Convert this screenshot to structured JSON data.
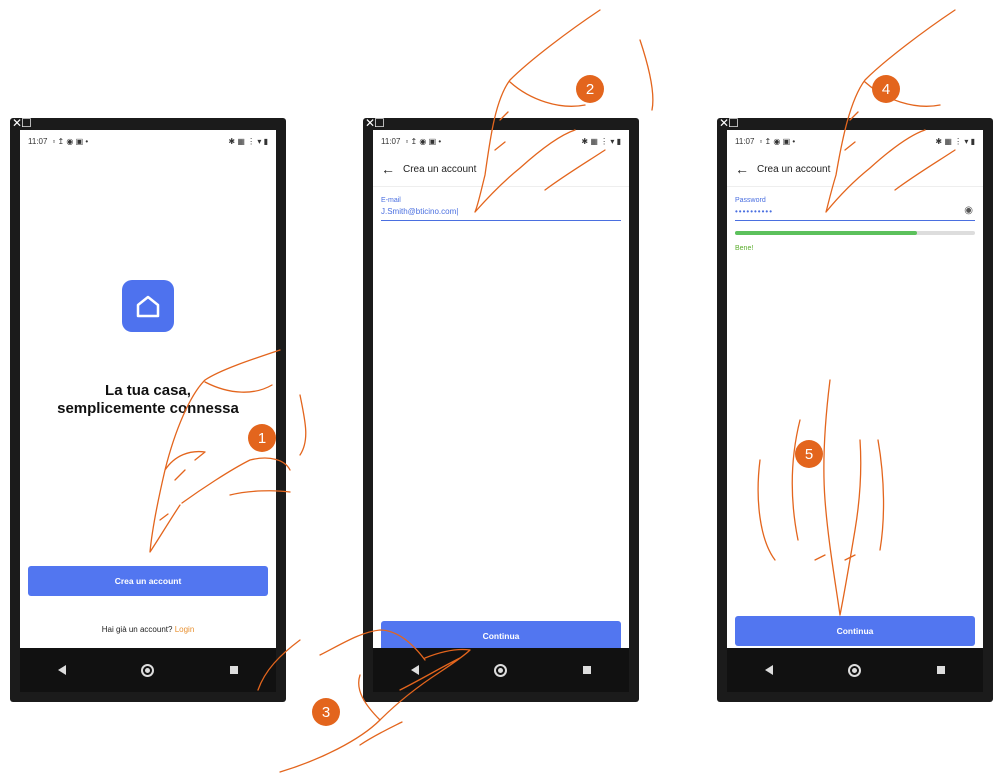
{
  "status_time": "11:07",
  "window_icons": "✕☐",
  "phone1": {
    "headline_line1": "La tua casa,",
    "headline_line2": "semplicemente connessa",
    "create_button": "Crea un account",
    "login_prompt": "Hai già un account?",
    "login_link": "Login"
  },
  "phone2": {
    "title": "Crea un account",
    "email_label": "E-mail",
    "email_value": "J.Smith@bticino.com",
    "continue_button": "Continua"
  },
  "phone3": {
    "title": "Crea un account",
    "password_label": "Password",
    "password_value": "••••••••••",
    "strength_fraction": 0.76,
    "strength_text": "Bene!",
    "continue_button": "Continua"
  },
  "steps": [
    "1",
    "2",
    "3",
    "4",
    "5"
  ],
  "colors": {
    "accent": "#5276f0",
    "badge": "#e3651d",
    "strength": "#5cc15c",
    "link": "#e89030"
  }
}
